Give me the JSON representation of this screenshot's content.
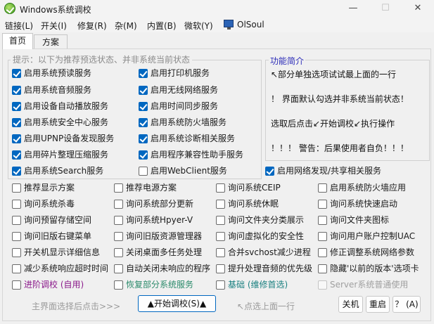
{
  "window": {
    "title": "Windows系统调校",
    "minimize": "—",
    "maximize": "☐",
    "close": "✕"
  },
  "menu": [
    "链接(L)",
    "开关(I)",
    "修复(R)",
    "杂(M)",
    "内置(B)",
    "微软(Y)",
    "OlSoul"
  ],
  "tabs": [
    "首页",
    "方案"
  ],
  "group_legend": "提示：以下为推荐预选状态、并非系统当前状态",
  "info": {
    "legend": "功能简介",
    "lines": [
      "↖部分单独选项试试最上面的一行",
      "！ 界面默认勾选并非系统当前状态！",
      "选取后点击↙开始调校↙执行操作",
      "！！！ 警告：后果使用者自负！！！"
    ]
  },
  "checkboxes": [
    {
      "label": "启用系统预读服务",
      "state": "on"
    },
    {
      "label": "启用打印机服务",
      "state": "on"
    },
    {
      "label": "启用系统音频服务",
      "state": "on"
    },
    {
      "label": "启用无线网络服务",
      "state": "on"
    },
    {
      "label": "启用设备自动播放服务",
      "state": "on"
    },
    {
      "label": "启用时间同步服务",
      "state": "on"
    },
    {
      "label": "启用系统安全中心服务",
      "state": "on"
    },
    {
      "label": "启用系统防火墙服务",
      "state": "on"
    },
    {
      "label": "启用UPNP设备发现服务",
      "state": "on"
    },
    {
      "label": "启用系统诊断相关服务",
      "state": "on"
    },
    {
      "label": "启用碎片整理压缩服务",
      "state": "on"
    },
    {
      "label": "启用程序兼容性助手服务",
      "state": "on"
    },
    {
      "label": "启用系统Search服务",
      "state": "on"
    },
    {
      "label": "启用WebClient服务",
      "state": "off"
    },
    {
      "label": "启用网络发现/共享相关服务",
      "state": "on"
    },
    {
      "label": "推荐显示方案",
      "state": "off"
    },
    {
      "label": "推荐电源方案",
      "state": "off"
    },
    {
      "label": "询问系统CEIP",
      "state": "off"
    },
    {
      "label": "启用系统防火墙应用",
      "state": "off"
    },
    {
      "label": "询问系统杀毒",
      "state": "off"
    },
    {
      "label": "询问系统部分更新",
      "state": "off"
    },
    {
      "label": "询问系统休眠",
      "state": "off"
    },
    {
      "label": "询问系统快速启动",
      "state": "off"
    },
    {
      "label": "询问预留存储空间",
      "state": "off"
    },
    {
      "label": "询问系统Hpyer-V",
      "state": "off"
    },
    {
      "label": "询问文件夹分类展示",
      "state": "off"
    },
    {
      "label": "询问文件夹图标",
      "state": "off"
    },
    {
      "label": "询问旧版右键菜单",
      "state": "off"
    },
    {
      "label": "询问旧版资源管理器",
      "state": "off"
    },
    {
      "label": "询问虚拟化的安全性",
      "state": "off"
    },
    {
      "label": "询问用户账户控制UAC",
      "state": "off"
    },
    {
      "label": "开关机显示详细信息",
      "state": "off"
    },
    {
      "label": "关闭桌面多任务处理",
      "state": "off"
    },
    {
      "label": "合并svchost减少进程",
      "state": "off"
    },
    {
      "label": "修正调整系统网络参数",
      "state": "off"
    },
    {
      "label": "减少系统响应超时时间",
      "state": "off"
    },
    {
      "label": "自动关闭未响应的程序",
      "state": "off"
    },
    {
      "label": "提升处理音频的优先级",
      "state": "off"
    },
    {
      "label": "隐藏'以前的版本'选项卡",
      "state": "off"
    },
    {
      "label": "进阶调校 (自用)",
      "state": "off"
    },
    {
      "label": "恢复部分系统服务",
      "state": "off"
    },
    {
      "label": "基础 (维修首选)",
      "state": "off"
    },
    {
      "label": "Server系统普通使用",
      "state": "disabled"
    }
  ],
  "bottom": {
    "hint_left": "主界面选择后点击>>>",
    "start_button": "▲开始调校(S)▲",
    "hint_right": "↖点选上面一行",
    "shutdown": "关机",
    "restart": "重启",
    "help": "？ (A)"
  }
}
